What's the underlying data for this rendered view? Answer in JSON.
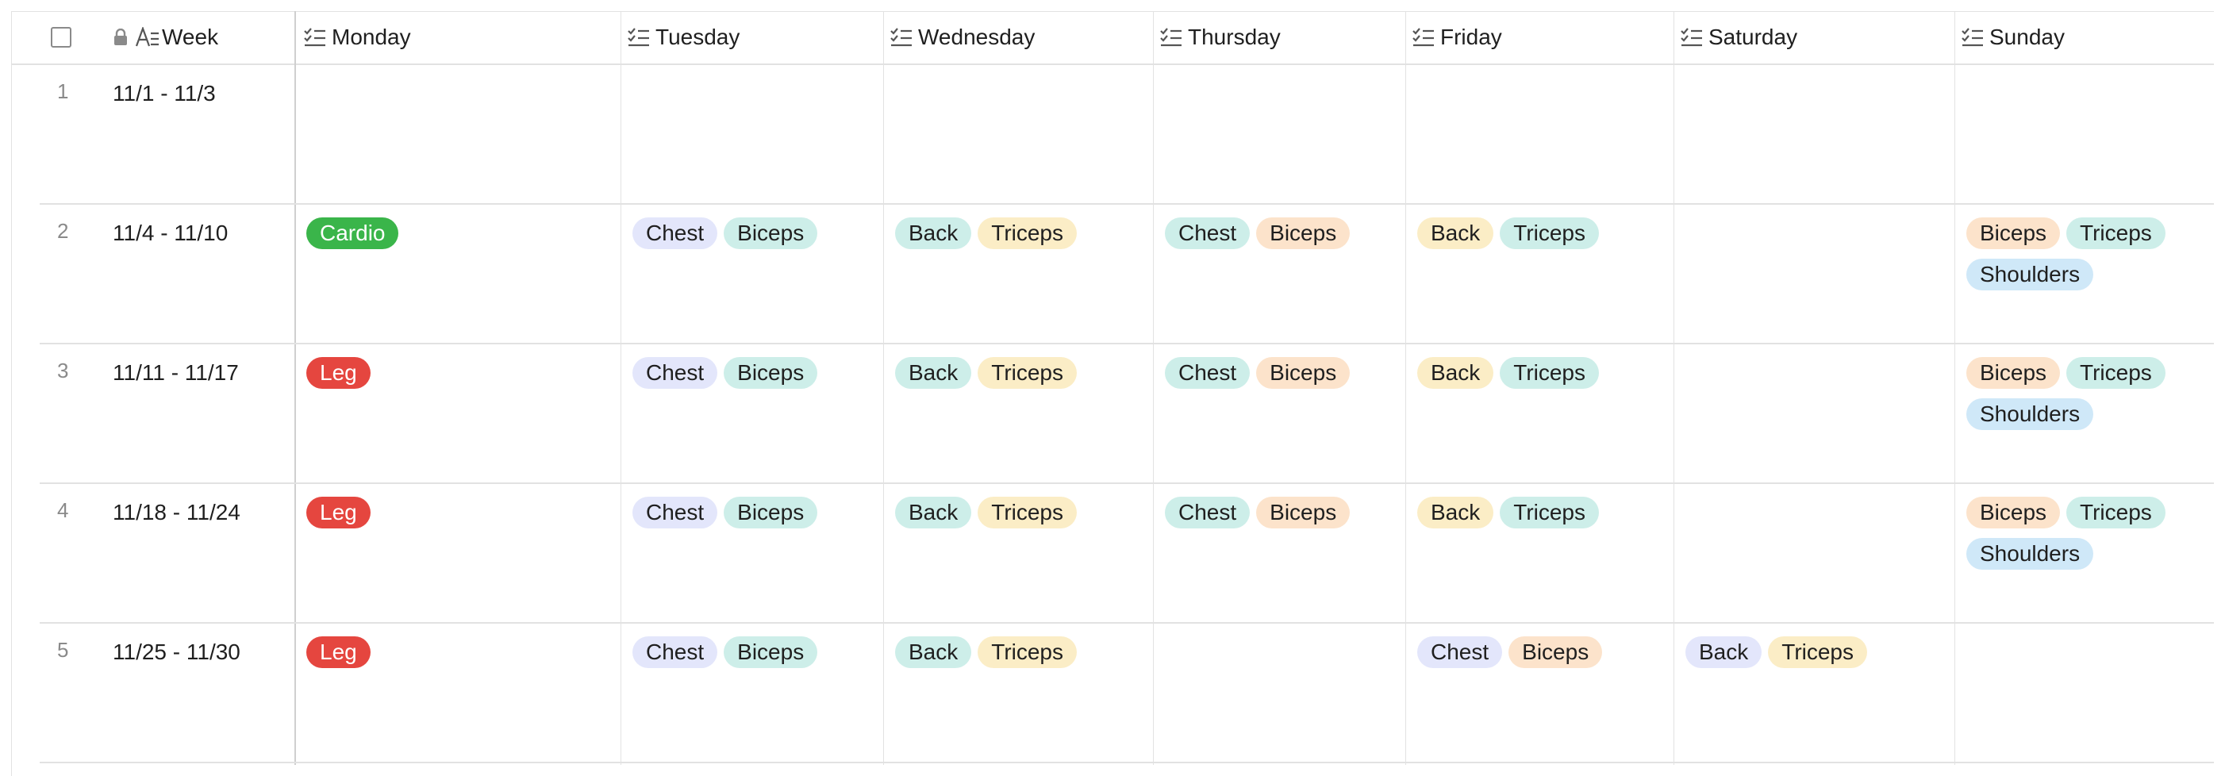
{
  "columns": {
    "week": "Week",
    "monday": "Monday",
    "tuesday": "Tuesday",
    "wednesday": "Wednesday",
    "thursday": "Thursday",
    "friday": "Friday",
    "saturday": "Saturday",
    "sunday": "Sunday"
  },
  "icons": {
    "header_lock": "lock-icon",
    "header_text": "text-property-icon",
    "header_multiselect": "checklist-icon"
  },
  "colors": {
    "cardio": "#3ab54a",
    "leg": "#e5463f",
    "purple": "#e3e6fb",
    "teal": "#cdeee9",
    "orange": "#fce3cb",
    "yellow": "#fbedc6",
    "blue": "#cfe8f8"
  },
  "rows": [
    {
      "num": "1",
      "week": "11/1 - 11/3",
      "monday": [],
      "tuesday": [],
      "wednesday": [],
      "thursday": [],
      "friday": [],
      "saturday": [],
      "sunday": []
    },
    {
      "num": "2",
      "week": "11/4 - 11/10",
      "monday": [
        "Cardio"
      ],
      "tuesday": [
        "Chest",
        "Biceps"
      ],
      "wednesday": [
        "Back",
        "Triceps"
      ],
      "thursday": [
        "Chest",
        "Biceps"
      ],
      "friday": [
        "Back",
        "Triceps"
      ],
      "saturday": [],
      "sunday": [
        "Biceps",
        "Triceps",
        "Shoulders"
      ]
    },
    {
      "num": "3",
      "week": "11/11 - 11/17",
      "monday": [
        "Leg"
      ],
      "tuesday": [
        "Chest",
        "Biceps"
      ],
      "wednesday": [
        "Back",
        "Triceps"
      ],
      "thursday": [
        "Chest",
        "Biceps"
      ],
      "friday": [
        "Back",
        "Triceps"
      ],
      "saturday": [],
      "sunday": [
        "Biceps",
        "Triceps",
        "Shoulders"
      ]
    },
    {
      "num": "4",
      "week": "11/18 - 11/24",
      "monday": [
        "Leg"
      ],
      "tuesday": [
        "Chest",
        "Biceps"
      ],
      "wednesday": [
        "Back",
        "Triceps"
      ],
      "thursday": [
        "Chest",
        "Biceps"
      ],
      "friday": [
        "Back",
        "Triceps"
      ],
      "saturday": [],
      "sunday": [
        "Biceps",
        "Triceps",
        "Shoulders"
      ]
    },
    {
      "num": "5",
      "week": "11/25 - 11/30",
      "monday": [
        "Leg"
      ],
      "tuesday": [
        "Chest",
        "Biceps"
      ],
      "wednesday": [
        "Back",
        "Triceps"
      ],
      "thursday": [],
      "friday": [
        "Chest",
        "Biceps"
      ],
      "saturday": [
        "Back",
        "Triceps"
      ],
      "sunday": []
    }
  ]
}
